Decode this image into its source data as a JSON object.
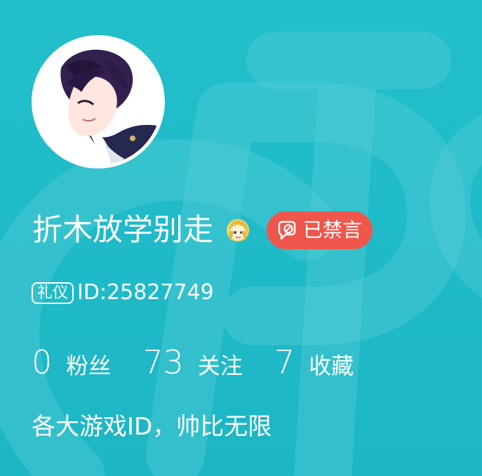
{
  "profile": {
    "avatar_icon": "anime-boy-avatar-icon",
    "username": "折木放学别走",
    "level_badge_icon": "blonde-girl-emoji-icon",
    "muted_badge": {
      "label": "已禁言",
      "icon": "muted-chat-icon",
      "color": "#ef574c"
    },
    "etiquette_tag": "礼仪",
    "id_text": "ID:25827749",
    "stats": [
      {
        "value": "0",
        "label": "粉丝"
      },
      {
        "value": "73",
        "label": "关注"
      },
      {
        "value": "7",
        "label": "收藏"
      }
    ],
    "bio": "各大游戏ID，帅比无限"
  },
  "theme": {
    "background": "#1fbac7",
    "text": "#ffffff"
  }
}
